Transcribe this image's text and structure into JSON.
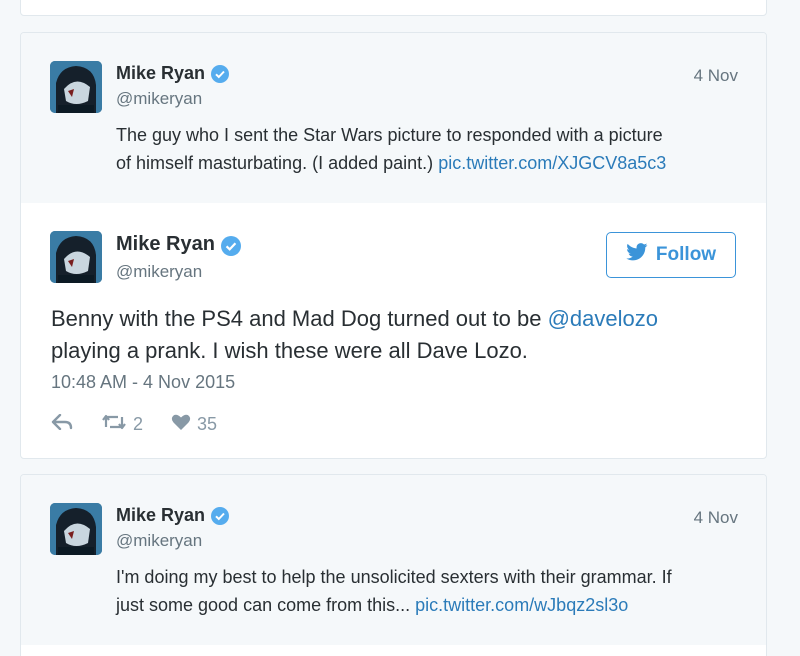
{
  "colors": {
    "link": "#2b7bb9",
    "follow_blue": "#3b94d9",
    "verified_blue": "#55acee",
    "muted": "#66757f",
    "parent_bg": "#f5f8fa"
  },
  "parent_tweet": {
    "name": "Mike Ryan",
    "handle": "@mikeryan",
    "date": "4 Nov",
    "text_line1": "The guy who I sent the Star Wars picture to responded with a picture",
    "text_line2": "of himself masturbating. (I added paint.)",
    "link": "pic.twitter.com/XJGCV8a5c3"
  },
  "main_tweet": {
    "name": "Mike Ryan",
    "handle": "@mikeryan",
    "follow_label": "Follow",
    "text_line1_prefix": "Benny with the PS4 and Mad Dog turned out to be",
    "mention": "@davelozo",
    "text_line2": "playing a prank. I wish these were all Dave Lozo.",
    "timestamp": "10:48 AM - 4 Nov 2015",
    "retweets": "2",
    "likes": "35",
    "icons": [
      "reply-icon",
      "retweet-icon",
      "heart-icon"
    ]
  },
  "reply_tweet": {
    "name": "Mike Ryan",
    "handle": "@mikeryan",
    "date": "4 Nov",
    "text_line1": "I'm doing my best to help the unsolicited sexters with their grammar. If",
    "text_line2": "just some good can come from this...",
    "link": "pic.twitter.com/wJbqz2sl3o"
  }
}
